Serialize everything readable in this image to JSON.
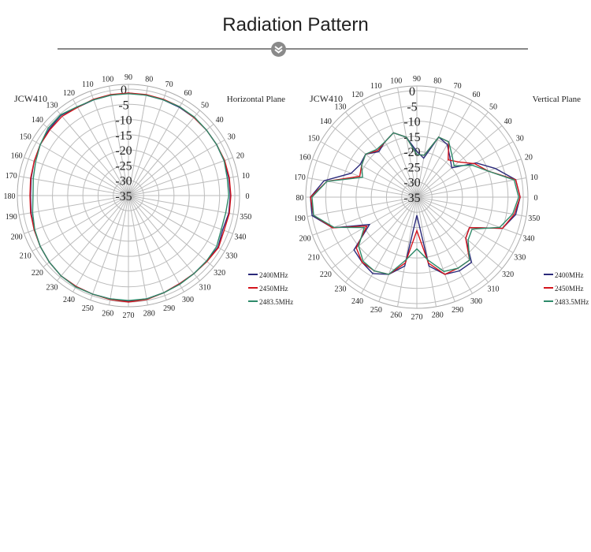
{
  "header": {
    "title": "Radiation Pattern",
    "divider_icon": "double-chevron-down-icon"
  },
  "chart_data": [
    {
      "type": "polar-line",
      "model_label": "JCW410",
      "plane_label": "Horizontal Plane",
      "angle_ticks": [
        "0",
        "10",
        "20",
        "30",
        "40",
        "50",
        "60",
        "70",
        "80",
        "90",
        "100",
        "110",
        "120",
        "130",
        "140",
        "150",
        "160",
        "170",
        "180",
        "190",
        "200",
        "210",
        "220",
        "230",
        "240",
        "250",
        "260",
        "270",
        "280",
        "290",
        "300",
        "310",
        "320",
        "330",
        "340",
        "350"
      ],
      "radial_ticks": [
        "0",
        "-5",
        "-10",
        "-15",
        "-20",
        "-25",
        "-30",
        "-35"
      ],
      "rlim": [
        -35,
        0
      ],
      "grid": true,
      "legend_position": "bottom-right",
      "series": [
        {
          "name": "2400MHz",
          "color": "#2b2a7a",
          "values": [
            -1.5,
            -1.5,
            -1.5,
            -1.5,
            -1.5,
            -1.5,
            -1.5,
            -1.5,
            -1.5,
            -1.3,
            -1.5,
            -1.5,
            -1.5,
            -0.5,
            -1,
            -1.5,
            -2,
            -2.5,
            -2.8,
            -2.5,
            -2,
            -1.5,
            -1,
            -0.5,
            -0.5,
            -0.5,
            -0.5,
            -0.3,
            -0.5,
            -1,
            -1.5,
            -1.5,
            -1.5,
            -1,
            -2,
            -1.5
          ]
        },
        {
          "name": "2450MHz",
          "color": "#d4141c",
          "values": [
            -1.3,
            -1.3,
            -1.3,
            -1.5,
            -1.5,
            -1.5,
            -1.3,
            -1.3,
            -1.3,
            -1.3,
            -1.3,
            -1.3,
            -1.5,
            -1,
            -1.3,
            -1.5,
            -2,
            -2.3,
            -2.6,
            -2.3,
            -2,
            -1.5,
            -1,
            -0.5,
            -0.5,
            -0.5,
            -0.3,
            0,
            -0.3,
            -1,
            -1.5,
            -1.5,
            -1.3,
            -0.8,
            -1.5,
            -1.3
          ]
        },
        {
          "name": "2483.5MHz",
          "color": "#2e8a6a",
          "values": [
            -2,
            -2,
            -1.5,
            -1.5,
            -1.5,
            -1.3,
            -1.3,
            -1.5,
            -1.5,
            -1.5,
            -1.5,
            -1.5,
            -1.3,
            -0.3,
            -0.5,
            -1.5,
            -2.5,
            -3.2,
            -3.6,
            -3,
            -2.2,
            -1.5,
            -1,
            -0.5,
            -0.3,
            -0.5,
            -0.5,
            -0.5,
            -0.5,
            -1,
            -1.3,
            -1.5,
            -1.5,
            -1.5,
            -2.5,
            -2.5
          ]
        }
      ]
    },
    {
      "type": "polar-line",
      "model_label": "JCW410",
      "plane_label": "Vertical  Plane",
      "angle_ticks": [
        "0",
        "10",
        "20",
        "30",
        "40",
        "50",
        "60",
        "70",
        "80",
        "90",
        "100",
        "110",
        "120",
        "130",
        "140",
        "150",
        "160",
        "170",
        "180",
        "190",
        "200",
        "210",
        "220",
        "230",
        "240",
        "250",
        "260",
        "270",
        "280",
        "290",
        "300",
        "310",
        "320",
        "330",
        "340",
        "350"
      ],
      "radial_ticks": [
        "0",
        "-5",
        "-10",
        "-15",
        "-20",
        "-25",
        "-30",
        "-35"
      ],
      "rlim": [
        -35,
        0
      ],
      "grid": true,
      "legend_position": "bottom-right",
      "series": [
        {
          "name": "2400MHz",
          "color": "#2b2a7a",
          "values": [
            -1,
            -2,
            -7.5,
            -12.5,
            -20,
            -18,
            -15,
            -14,
            -22,
            -20,
            -15,
            -12.5,
            -14,
            -15.5,
            -13,
            -13.5,
            -12,
            -4,
            0,
            0,
            -5.5,
            -17,
            -8,
            -7,
            -6,
            -8,
            -12,
            -29,
            -12,
            -8,
            -7,
            -7,
            -14,
            -15,
            -5,
            -2
          ]
        },
        {
          "name": "2450MHz",
          "color": "#d4141c",
          "values": [
            -1,
            -2,
            -10,
            -13,
            -17,
            -19,
            -14,
            -14,
            -21,
            -21,
            -15,
            -12.5,
            -14,
            -15,
            -13,
            -14,
            -15,
            -5,
            0,
            -0.5,
            -5.5,
            -16,
            -9,
            -7,
            -7,
            -8,
            -13,
            -24,
            -13,
            -8,
            -8,
            -8,
            -14,
            -15,
            -5,
            -2.5
          ]
        },
        {
          "name": "2483.5MHz",
          "color": "#2e8a6a",
          "values": [
            -1.5,
            -2.5,
            -10,
            -14,
            -19,
            -17,
            -14,
            -14,
            -21,
            -21,
            -15,
            -12.5,
            -14,
            -14.5,
            -13,
            -14,
            -16,
            -5,
            -0.5,
            -0.5,
            -6,
            -15,
            -10,
            -7.5,
            -7,
            -8,
            -14,
            -18,
            -14,
            -9,
            -8,
            -8,
            -13,
            -14,
            -6,
            -3
          ]
        }
      ]
    }
  ]
}
